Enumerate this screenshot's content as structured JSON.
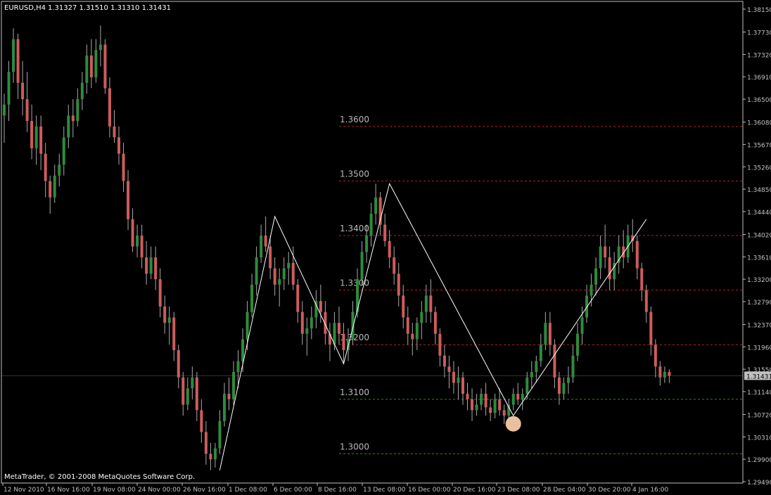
{
  "header": {
    "symbol_label": "EURUSD,H4",
    "ohlc_label": "1.31327 1.31510 1.31310 1.31431"
  },
  "footer": {
    "copyright": "MetaTrader, © 2001-2008 MetaQuotes Software Corp."
  },
  "colors": {
    "background": "#000000",
    "frame": "#c0c0c0",
    "bull_candle": "#2e8b3c",
    "bear_candle": "#cd5c5c",
    "wick": "#aaaaaa",
    "resistance_line": "#b22222",
    "support_line": "#2e8b2e",
    "zigzag": "#ffffff",
    "bid_line": "#333333",
    "highlight_circle": "#f5cba7"
  },
  "chart_data": {
    "type": "candlestick",
    "price_axis_ticks": [
      "1.38150",
      "1.37730",
      "1.37320",
      "1.36910",
      "1.36500",
      "1.36080",
      "1.35670",
      "1.35260",
      "1.34850",
      "1.34440",
      "1.34020",
      "1.33610",
      "1.33200",
      "1.32790",
      "1.32370",
      "1.31960",
      "1.31550",
      "1.31140",
      "1.30720",
      "1.30310",
      "1.29900",
      "1.29490"
    ],
    "time_axis_labels": [
      "12 Nov 2010",
      "16 Nov 16:00",
      "19 Nov 08:00",
      "24 Nov 00:00",
      "26 Nov 16:00",
      "1 Dec 08:00",
      "6 Dec 00:00",
      "8 Dec 16:00",
      "13 Dec 08:00",
      "16 Dec 00:00",
      "20 Dec 16:00",
      "23 Dec 08:00",
      "28 Dec 04:00",
      "30 Dec 20:00",
      "4 Jan 16:00"
    ],
    "current_price": "1.31431",
    "ylim": [
      1.2949,
      1.3815
    ],
    "levels": [
      {
        "label": "1.3600",
        "price": 1.36,
        "kind": "resistance"
      },
      {
        "label": "1.3500",
        "price": 1.35,
        "kind": "resistance"
      },
      {
        "label": "1.3400",
        "price": 1.34,
        "kind": "resistance"
      },
      {
        "label": "1.3300",
        "price": 1.33,
        "kind": "resistance"
      },
      {
        "label": "1.3200",
        "price": 1.32,
        "kind": "resistance"
      },
      {
        "label": "1.3100",
        "price": 1.31,
        "kind": "support"
      },
      {
        "label": "1.3000",
        "price": 1.3,
        "kind": "support"
      }
    ],
    "zigzag": [
      {
        "bar": 47,
        "price": 1.297
      },
      {
        "bar": 59,
        "price": 1.3435
      },
      {
        "bar": 74,
        "price": 1.3165
      },
      {
        "bar": 84,
        "price": 1.3495
      },
      {
        "bar": 111,
        "price": 1.307
      },
      {
        "bar": 140,
        "price": 1.343
      }
    ],
    "highlight": {
      "bar": 111,
      "price": 1.3055
    },
    "candles": [
      [
        1.362,
        1.366,
        1.357,
        1.364
      ],
      [
        1.364,
        1.372,
        1.361,
        1.37
      ],
      [
        1.37,
        1.378,
        1.368,
        1.376
      ],
      [
        1.376,
        1.377,
        1.365,
        1.368
      ],
      [
        1.368,
        1.372,
        1.362,
        1.365
      ],
      [
        1.365,
        1.37,
        1.359,
        1.361
      ],
      [
        1.361,
        1.364,
        1.354,
        1.356
      ],
      [
        1.356,
        1.362,
        1.353,
        1.36
      ],
      [
        1.36,
        1.362,
        1.352,
        1.355
      ],
      [
        1.355,
        1.357,
        1.347,
        1.35
      ],
      [
        1.35,
        1.351,
        1.344,
        1.347
      ],
      [
        1.347,
        1.353,
        1.346,
        1.351
      ],
      [
        1.351,
        1.355,
        1.349,
        1.353
      ],
      [
        1.353,
        1.36,
        1.351,
        1.358
      ],
      [
        1.358,
        1.364,
        1.356,
        1.362
      ],
      [
        1.362,
        1.365,
        1.358,
        1.361
      ],
      [
        1.361,
        1.367,
        1.36,
        1.365
      ],
      [
        1.365,
        1.37,
        1.363,
        1.368
      ],
      [
        1.368,
        1.375,
        1.366,
        1.373
      ],
      [
        1.373,
        1.376,
        1.367,
        1.369
      ],
      [
        1.369,
        1.376,
        1.368,
        1.374
      ],
      [
        1.374,
        1.3785,
        1.371,
        1.375
      ],
      [
        1.375,
        1.376,
        1.366,
        1.367
      ],
      [
        1.367,
        1.369,
        1.358,
        1.36
      ],
      [
        1.36,
        1.363,
        1.357,
        1.358
      ],
      [
        1.358,
        1.36,
        1.353,
        1.355
      ],
      [
        1.355,
        1.357,
        1.348,
        1.35
      ],
      [
        1.35,
        1.352,
        1.341,
        1.343
      ],
      [
        1.343,
        1.345,
        1.337,
        1.338
      ],
      [
        1.338,
        1.342,
        1.336,
        1.34
      ],
      [
        1.34,
        1.342,
        1.334,
        1.336
      ],
      [
        1.336,
        1.339,
        1.331,
        1.333
      ],
      [
        1.333,
        1.338,
        1.332,
        1.336
      ],
      [
        1.336,
        1.338,
        1.33,
        1.332
      ],
      [
        1.332,
        1.334,
        1.325,
        1.327
      ],
      [
        1.327,
        1.329,
        1.322,
        1.324
      ],
      [
        1.324,
        1.327,
        1.32,
        1.325
      ],
      [
        1.325,
        1.326,
        1.317,
        1.319
      ],
      [
        1.319,
        1.32,
        1.312,
        1.314
      ],
      [
        1.314,
        1.315,
        1.307,
        1.309
      ],
      [
        1.309,
        1.314,
        1.308,
        1.312
      ],
      [
        1.312,
        1.316,
        1.31,
        1.314
      ],
      [
        1.314,
        1.315,
        1.306,
        1.308
      ],
      [
        1.308,
        1.31,
        1.302,
        1.304
      ],
      [
        1.304,
        1.306,
        1.298,
        1.3
      ],
      [
        1.3,
        1.302,
        1.297,
        1.299
      ],
      [
        1.299,
        1.302,
        1.2975,
        1.301
      ],
      [
        1.301,
        1.308,
        1.3,
        1.306
      ],
      [
        1.306,
        1.313,
        1.305,
        1.311
      ],
      [
        1.311,
        1.314,
        1.308,
        1.31
      ],
      [
        1.31,
        1.317,
        1.309,
        1.315
      ],
      [
        1.315,
        1.319,
        1.312,
        1.317
      ],
      [
        1.317,
        1.323,
        1.315,
        1.321
      ],
      [
        1.321,
        1.328,
        1.319,
        1.326
      ],
      [
        1.326,
        1.333,
        1.325,
        1.331
      ],
      [
        1.331,
        1.338,
        1.329,
        1.336
      ],
      [
        1.336,
        1.342,
        1.335,
        1.34
      ],
      [
        1.34,
        1.3435,
        1.337,
        1.338
      ],
      [
        1.338,
        1.34,
        1.332,
        1.334
      ],
      [
        1.334,
        1.336,
        1.329,
        1.331
      ],
      [
        1.331,
        1.334,
        1.327,
        1.332
      ],
      [
        1.332,
        1.336,
        1.33,
        1.334
      ],
      [
        1.334,
        1.337,
        1.331,
        1.335
      ],
      [
        1.335,
        1.338,
        1.33,
        1.331
      ],
      [
        1.331,
        1.332,
        1.324,
        1.326
      ],
      [
        1.326,
        1.328,
        1.32,
        1.322
      ],
      [
        1.322,
        1.325,
        1.318,
        1.323
      ],
      [
        1.323,
        1.327,
        1.321,
        1.325
      ],
      [
        1.325,
        1.33,
        1.323,
        1.328
      ],
      [
        1.328,
        1.331,
        1.324,
        1.326
      ],
      [
        1.326,
        1.328,
        1.32,
        1.322
      ],
      [
        1.322,
        1.324,
        1.317,
        1.32
      ],
      [
        1.32,
        1.326,
        1.319,
        1.324
      ],
      [
        1.324,
        1.327,
        1.32,
        1.322
      ],
      [
        1.322,
        1.324,
        1.3165,
        1.319
      ],
      [
        1.319,
        1.323,
        1.317,
        1.321
      ],
      [
        1.321,
        1.328,
        1.32,
        1.326
      ],
      [
        1.326,
        1.334,
        1.325,
        1.332
      ],
      [
        1.332,
        1.339,
        1.331,
        1.337
      ],
      [
        1.337,
        1.342,
        1.335,
        1.34
      ],
      [
        1.34,
        1.346,
        1.338,
        1.344
      ],
      [
        1.344,
        1.3495,
        1.342,
        1.347
      ],
      [
        1.347,
        1.348,
        1.34,
        1.342
      ],
      [
        1.342,
        1.344,
        1.338,
        1.339
      ],
      [
        1.339,
        1.341,
        1.334,
        1.336
      ],
      [
        1.336,
        1.338,
        1.331,
        1.333
      ],
      [
        1.333,
        1.335,
        1.327,
        1.329
      ],
      [
        1.329,
        1.331,
        1.323,
        1.325
      ],
      [
        1.325,
        1.327,
        1.32,
        1.322
      ],
      [
        1.322,
        1.324,
        1.318,
        1.321
      ],
      [
        1.321,
        1.325,
        1.319,
        1.324
      ],
      [
        1.324,
        1.328,
        1.321,
        1.326
      ],
      [
        1.326,
        1.331,
        1.324,
        1.329
      ],
      [
        1.329,
        1.332,
        1.324,
        1.326
      ],
      [
        1.326,
        1.327,
        1.32,
        1.322
      ],
      [
        1.322,
        1.323,
        1.316,
        1.318
      ],
      [
        1.318,
        1.32,
        1.314,
        1.316
      ],
      [
        1.316,
        1.318,
        1.312,
        1.315
      ],
      [
        1.315,
        1.317,
        1.311,
        1.313
      ],
      [
        1.313,
        1.316,
        1.31,
        1.314
      ],
      [
        1.314,
        1.315,
        1.309,
        1.311
      ],
      [
        1.311,
        1.313,
        1.308,
        1.31
      ],
      [
        1.31,
        1.312,
        1.306,
        1.308
      ],
      [
        1.308,
        1.311,
        1.307,
        1.309
      ],
      [
        1.309,
        1.312,
        1.308,
        1.311
      ],
      [
        1.311,
        1.313,
        1.307,
        1.3085
      ],
      [
        1.3085,
        1.31,
        1.306,
        1.3075
      ],
      [
        1.3075,
        1.311,
        1.3065,
        1.31
      ],
      [
        1.31,
        1.312,
        1.307,
        1.308
      ],
      [
        1.308,
        1.309,
        1.3055,
        1.307
      ],
      [
        1.307,
        1.31,
        1.306,
        1.309
      ],
      [
        1.309,
        1.312,
        1.308,
        1.311
      ],
      [
        1.311,
        1.313,
        1.309,
        1.31
      ],
      [
        1.31,
        1.312,
        1.308,
        1.311
      ],
      [
        1.311,
        1.315,
        1.31,
        1.314
      ],
      [
        1.314,
        1.317,
        1.312,
        1.315
      ],
      [
        1.315,
        1.318,
        1.313,
        1.317
      ],
      [
        1.317,
        1.322,
        1.316,
        1.32
      ],
      [
        1.32,
        1.326,
        1.319,
        1.324
      ],
      [
        1.324,
        1.326,
        1.318,
        1.32
      ],
      [
        1.32,
        1.321,
        1.312,
        1.314
      ],
      [
        1.314,
        1.315,
        1.309,
        1.311
      ],
      [
        1.311,
        1.314,
        1.31,
        1.313
      ],
      [
        1.313,
        1.316,
        1.311,
        1.314
      ],
      [
        1.314,
        1.32,
        1.313,
        1.318
      ],
      [
        1.318,
        1.324,
        1.317,
        1.322
      ],
      [
        1.322,
        1.327,
        1.32,
        1.325
      ],
      [
        1.325,
        1.331,
        1.324,
        1.329
      ],
      [
        1.329,
        1.333,
        1.327,
        1.331
      ],
      [
        1.331,
        1.336,
        1.329,
        1.334
      ],
      [
        1.334,
        1.34,
        1.332,
        1.338
      ],
      [
        1.338,
        1.342,
        1.334,
        1.336
      ],
      [
        1.336,
        1.338,
        1.33,
        1.332
      ],
      [
        1.332,
        1.337,
        1.33,
        1.335
      ],
      [
        1.335,
        1.34,
        1.333,
        1.338
      ],
      [
        1.338,
        1.341,
        1.334,
        1.336
      ],
      [
        1.336,
        1.342,
        1.335,
        1.34
      ],
      [
        1.34,
        1.343,
        1.337,
        1.339
      ],
      [
        1.339,
        1.34,
        1.332,
        1.334
      ],
      [
        1.334,
        1.335,
        1.328,
        1.33
      ],
      [
        1.33,
        1.331,
        1.324,
        1.326
      ],
      [
        1.326,
        1.327,
        1.318,
        1.32
      ],
      [
        1.32,
        1.321,
        1.314,
        1.316
      ],
      [
        1.316,
        1.317,
        1.3125,
        1.314
      ],
      [
        1.314,
        1.316,
        1.313,
        1.315
      ],
      [
        1.315,
        1.3155,
        1.313,
        1.3143
      ]
    ]
  }
}
